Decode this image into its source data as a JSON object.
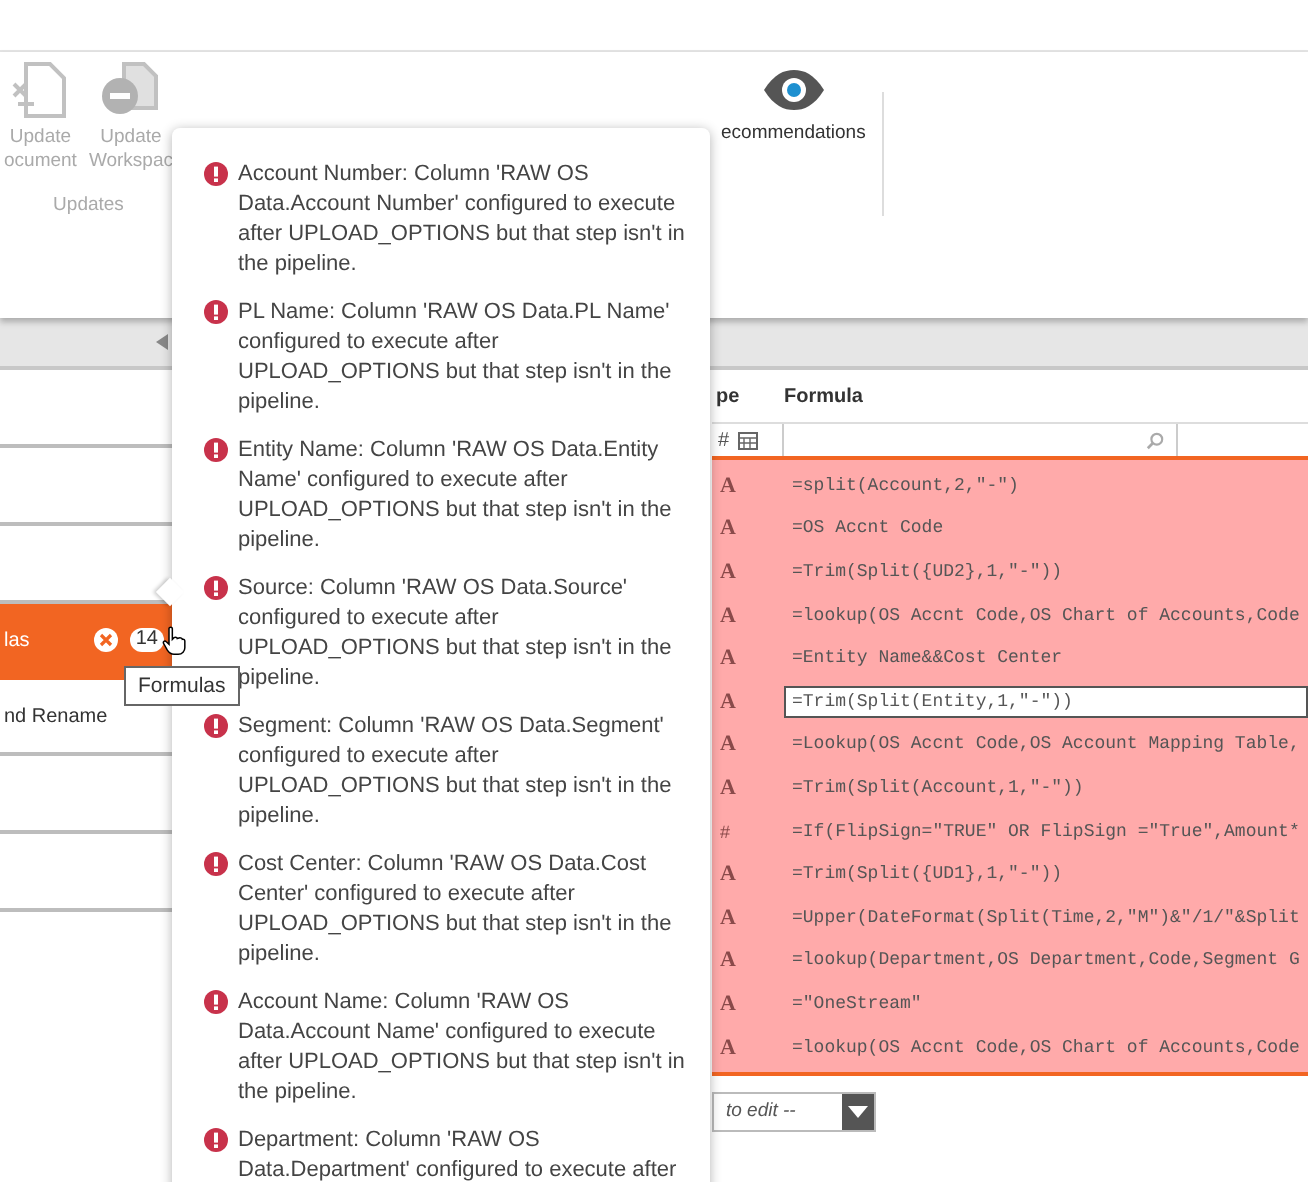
{
  "ribbon": {
    "buttons": [
      {
        "kind": "document",
        "line1": "Update",
        "line2": "ocument",
        "disabled": true
      },
      {
        "kind": "workspace",
        "line1": "Update",
        "line2": "Workspac",
        "disabled": true
      },
      {
        "kind": "eye",
        "line1": "ecommendations",
        "disabled": false
      }
    ],
    "group_label": "Updates"
  },
  "left_panel": {
    "items": [
      {
        "label": "las",
        "selected": true,
        "badge": "14"
      },
      {
        "label": "nd Rename",
        "selected": false
      }
    ]
  },
  "tooltip": "Formulas",
  "grid": {
    "columns": [
      "pe",
      "Formula"
    ],
    "filter_type": "#",
    "rows": [
      {
        "type": "A",
        "formula": "=split(Account,2,\"-\")",
        "selected": false
      },
      {
        "type": "A",
        "formula": "=OS Accnt Code",
        "selected": false
      },
      {
        "type": "A",
        "formula": "=Trim(Split({UD2},1,\"-\"))",
        "selected": false
      },
      {
        "type": "A",
        "formula": "=lookup(OS Accnt Code,OS Chart of Accounts,Code",
        "selected": false
      },
      {
        "type": "A",
        "formula": "=Entity Name&&Cost Center",
        "selected": false
      },
      {
        "type": "A",
        "formula": "=Trim(Split(Entity,1,\"-\"))",
        "selected": true
      },
      {
        "type": "A",
        "formula": "=Lookup(OS Accnt Code,OS Account Mapping Table,",
        "selected": false
      },
      {
        "type": "A",
        "formula": "=Trim(Split(Account,1,\"-\"))",
        "selected": false
      },
      {
        "type": "#",
        "formula": "=If(FlipSign=\"TRUE\" OR FlipSign =\"True\",Amount*",
        "selected": false
      },
      {
        "type": "A",
        "formula": "=Trim(Split({UD1},1,\"-\"))",
        "selected": false
      },
      {
        "type": "A",
        "formula": "=Upper(DateFormat(Split(Time,2,\"M\")&\"/1/\"&Split",
        "selected": false
      },
      {
        "type": "A",
        "formula": "=lookup(Department,OS Department,Code,Segment G",
        "selected": false
      },
      {
        "type": "A",
        "formula": "=\"OneStream\"",
        "selected": false
      },
      {
        "type": "A",
        "formula": "=lookup(OS Accnt Code,OS Chart of Accounts,Code",
        "selected": false
      }
    ]
  },
  "editor_dropdown": {
    "placeholder": "to edit --"
  },
  "popup": {
    "messages": [
      "Account Number: Column 'RAW OS Data.Account Number' configured to execute after UPLOAD_OPTIONS but that step isn't in the pipeline.",
      "PL Name: Column 'RAW OS Data.PL Name' configured to execute after UPLOAD_OPTIONS but that step isn't in the pipeline.",
      "Entity Name: Column 'RAW OS Data.Entity Name' configured to execute after UPLOAD_OPTIONS but that step isn't in the pipeline.",
      "Source: Column 'RAW OS Data.Source' configured to execute after UPLOAD_OPTIONS but that step isn't in the pipeline.",
      "Segment: Column 'RAW OS Data.Segment' configured to execute after UPLOAD_OPTIONS but that step isn't in the pipeline.",
      "Cost Center: Column 'RAW OS Data.Cost Center' configured to execute after UPLOAD_OPTIONS but that step isn't in the pipeline.",
      "Account Name: Column 'RAW OS Data.Account Name' configured to execute after UPLOAD_OPTIONS but that step isn't in the pipeline.",
      "Department: Column 'RAW OS Data.Department' configured to execute after"
    ]
  }
}
